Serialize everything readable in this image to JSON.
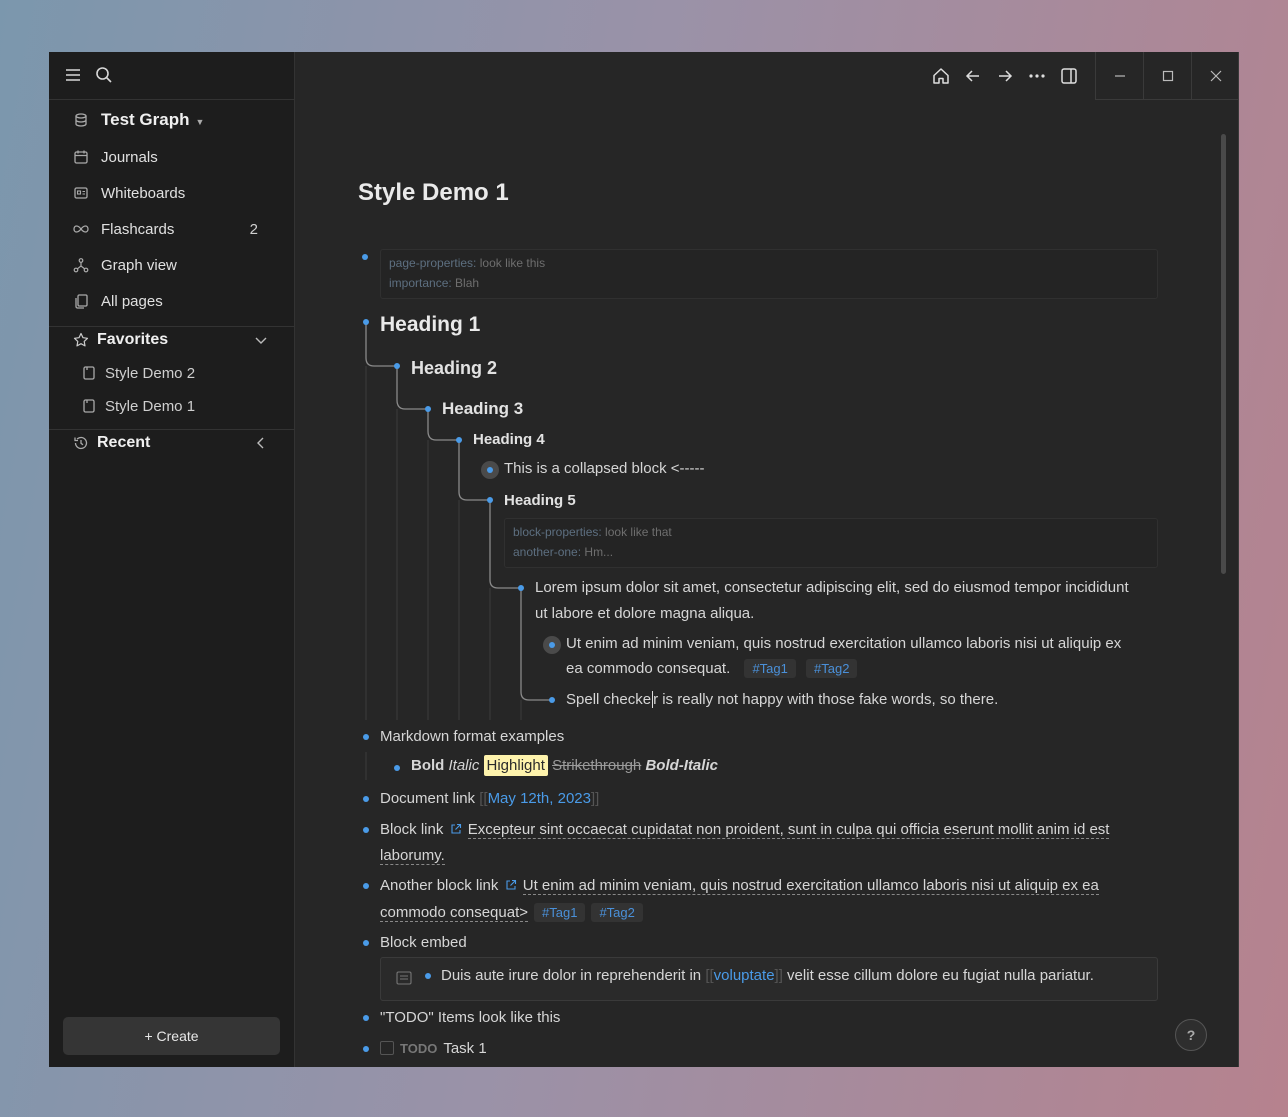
{
  "sidebar": {
    "graph_name": "Test Graph",
    "nav": [
      {
        "label": "Journals",
        "icon": "calendar-icon"
      },
      {
        "label": "Whiteboards",
        "icon": "whiteboard-icon"
      },
      {
        "label": "Flashcards",
        "icon": "infinity-icon",
        "count": "2"
      },
      {
        "label": "Graph view",
        "icon": "graph-icon"
      },
      {
        "label": "All pages",
        "icon": "pages-icon"
      }
    ],
    "favorites_title": "Favorites",
    "favorites": [
      "Style Demo 2",
      "Style Demo 1"
    ],
    "recent_title": "Recent",
    "create_label": "+ Create"
  },
  "page": {
    "title": "Style Demo 1",
    "page_properties": [
      {
        "key": "page-properties:",
        "value": " look like this"
      },
      {
        "key": "importance:",
        "value": " Blah"
      }
    ],
    "heading1": "Heading 1",
    "heading2": "Heading 2",
    "heading3": "Heading 3",
    "heading4": "Heading 4",
    "collapsed_block": "This is a collapsed block <-----",
    "heading5": "Heading 5",
    "block_properties": [
      {
        "key": "block-properties:",
        "value": " look like that"
      },
      {
        "key": "another-one:",
        "value": " Hm..."
      }
    ],
    "lorem_line1": "Lorem ipsum dolor sit amet, consectetur adipiscing elit, sed do eiusmod tempor incididunt",
    "lorem_line2": "ut labore et dolore magna aliqua.",
    "ut_line1": "Ut enim ad minim veniam, quis nostrud exercitation ullamco laboris nisi ut aliquip ex",
    "ut_line2": "ea commodo consequat.",
    "tag1": "#Tag1",
    "tag2": "#Tag2",
    "spell_a": "Spell checke",
    "spell_b": "r is really not happy with those fake words, so there.",
    "markdown_title": "Markdown format examples",
    "fmt_bold": "Bold",
    "fmt_italic": "Italic",
    "fmt_highlight": "Highlight",
    "fmt_strike": "Strikethrough",
    "fmt_bolditalic": "Bold-Italic",
    "doc_link_label": "Document link ",
    "doc_link_open": "[[",
    "doc_link_target": "May 12th, 2023",
    "doc_link_close": "]]",
    "block_link_label": "Block link ",
    "block_link_line1": "Excepteur sint occaecat cupidatat non proident, sunt in culpa qui officia eserunt mollit anim id est",
    "block_link_line2": "laborumy.",
    "another_link_label": "Another block link ",
    "another_link_line1": "Ut enim ad minim veniam, quis nostrud exercitation ullamco laboris nisi ut aliquip ex ea",
    "another_link_line2": "commodo consequat>",
    "embed_label": "Block embed",
    "embed_text_a": "Duis aute irure dolor in reprehenderit in ",
    "embed_link_open": "[[",
    "embed_link": "voluptate",
    "embed_link_close": "]]",
    "embed_text_b": " velit esse cillum dolore eu fugiat nulla pariatur.",
    "todo_title": "\"TODO\" Items look like this",
    "todo_keyword": "TODO",
    "todo_task": "Task 1"
  },
  "help_label": "?",
  "colors": {
    "accent": "#4a9be8",
    "highlight": "#fef3ac",
    "background": "#262626",
    "sidebar": "#1d1d1d"
  }
}
